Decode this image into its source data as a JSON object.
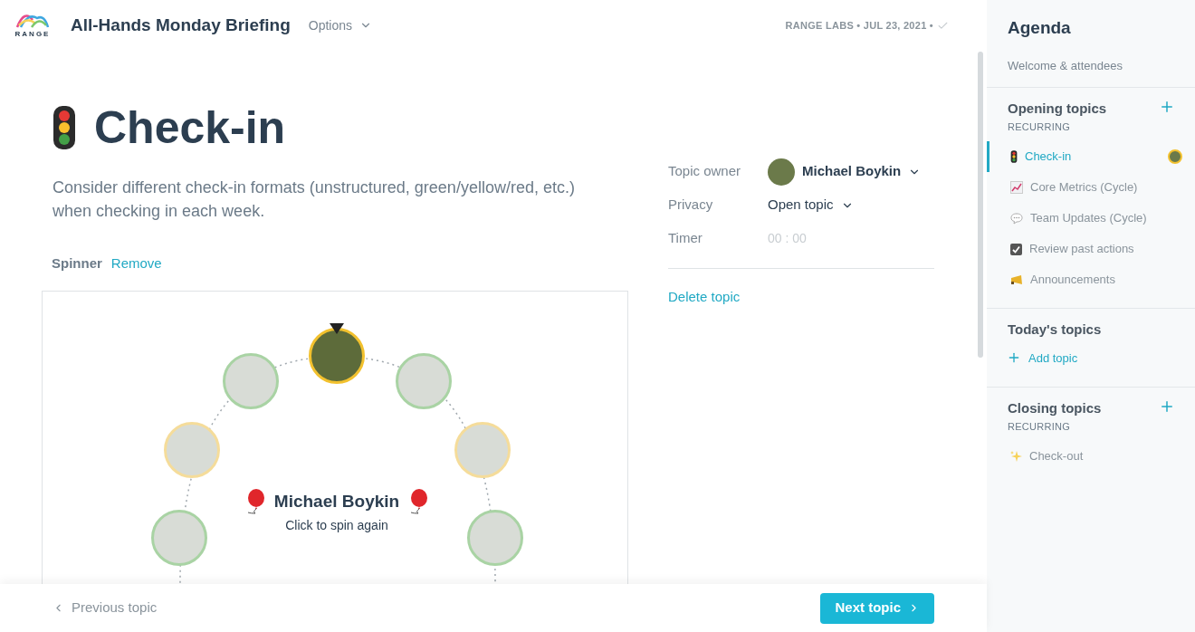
{
  "header": {
    "logo_text": "RANGE",
    "title": "All-Hands Monday Briefing",
    "options": "Options",
    "meta": "RANGE LABS • JUL 23, 2021 •"
  },
  "topic": {
    "title": "Check-in",
    "description": "Consider different check-in formats (unstructured, green/yellow/red, etc.) when checking in each week.",
    "spinner_label": "Spinner",
    "remove": "Remove"
  },
  "spinner": {
    "winner": "Michael Boykin",
    "hint": "Click to spin again",
    "avatars": [
      {
        "selected": true,
        "color": "#f2c12e"
      },
      {
        "selected": false,
        "color": "#a9d3a4"
      },
      {
        "selected": false,
        "color": "#a9d3a4"
      },
      {
        "selected": false,
        "color": "#f5dc9a"
      },
      {
        "selected": false,
        "color": "#f5dc9a"
      },
      {
        "selected": false,
        "color": "#a9d3a4"
      },
      {
        "selected": false,
        "color": "#a9d3a4"
      }
    ]
  },
  "details": {
    "fields": [
      {
        "kind": "person",
        "label": "Topic owner",
        "value": "Michael Boykin"
      },
      {
        "kind": "select",
        "label": "Privacy",
        "value": "Open topic"
      },
      {
        "kind": "input",
        "label": "Timer",
        "placeholder": "00 : 00"
      }
    ],
    "delete": "Delete topic"
  },
  "footer": {
    "previous": "Previous topic",
    "next": "Next topic"
  },
  "agenda": {
    "title": "Agenda",
    "intro": "Welcome & attendees",
    "sections": [
      {
        "title": "Opening topics",
        "subtitle": "RECURRING",
        "addable": true,
        "items": [
          {
            "kind": "traffic",
            "label": "Check-in",
            "selected": true
          },
          {
            "kind": "chart",
            "label": "Core Metrics (Cycle)",
            "selected": false
          },
          {
            "kind": "speech",
            "label": "Team Updates (Cycle)",
            "selected": false
          },
          {
            "kind": "checkbox",
            "label": "Review past actions",
            "selected": false
          },
          {
            "kind": "megaphone",
            "label": "Announcements",
            "selected": false
          }
        ]
      },
      {
        "title": "Today's topics",
        "add_label": "Add topic",
        "addable": false
      },
      {
        "title": "Closing topics",
        "subtitle": "RECURRING",
        "addable": true,
        "items": [
          {
            "kind": "sparkles",
            "label": "Check-out",
            "selected": false
          }
        ]
      }
    ]
  }
}
